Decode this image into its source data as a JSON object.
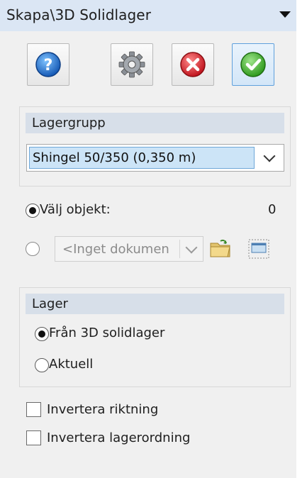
{
  "title": "Skapa\\3D Solidlager",
  "toolbar": {
    "help_icon": "question-mark-icon",
    "settings_icon": "gear-icon",
    "cancel_icon": "red-x-icon",
    "ok_icon": "green-check-icon"
  },
  "lagergrupp": {
    "header": "Lagergrupp",
    "selected": "Shingel 50/350 (0,350 m)"
  },
  "select_object": {
    "label": "Välj objekt:",
    "count": "0"
  },
  "document": {
    "value": "<Inget dokumen"
  },
  "lager": {
    "header": "Lager",
    "option1": "Från 3D solidlager",
    "option2": "Aktuell"
  },
  "options": {
    "invert_direction": "Invertera riktning",
    "invert_order": "Invertera lagerordning"
  },
  "colors": {
    "title_bg": "#dbe6f4",
    "group_header_bg": "#d7dfe9",
    "selection_bg": "#cce4f7",
    "active_button_border": "#5fa0dc"
  }
}
